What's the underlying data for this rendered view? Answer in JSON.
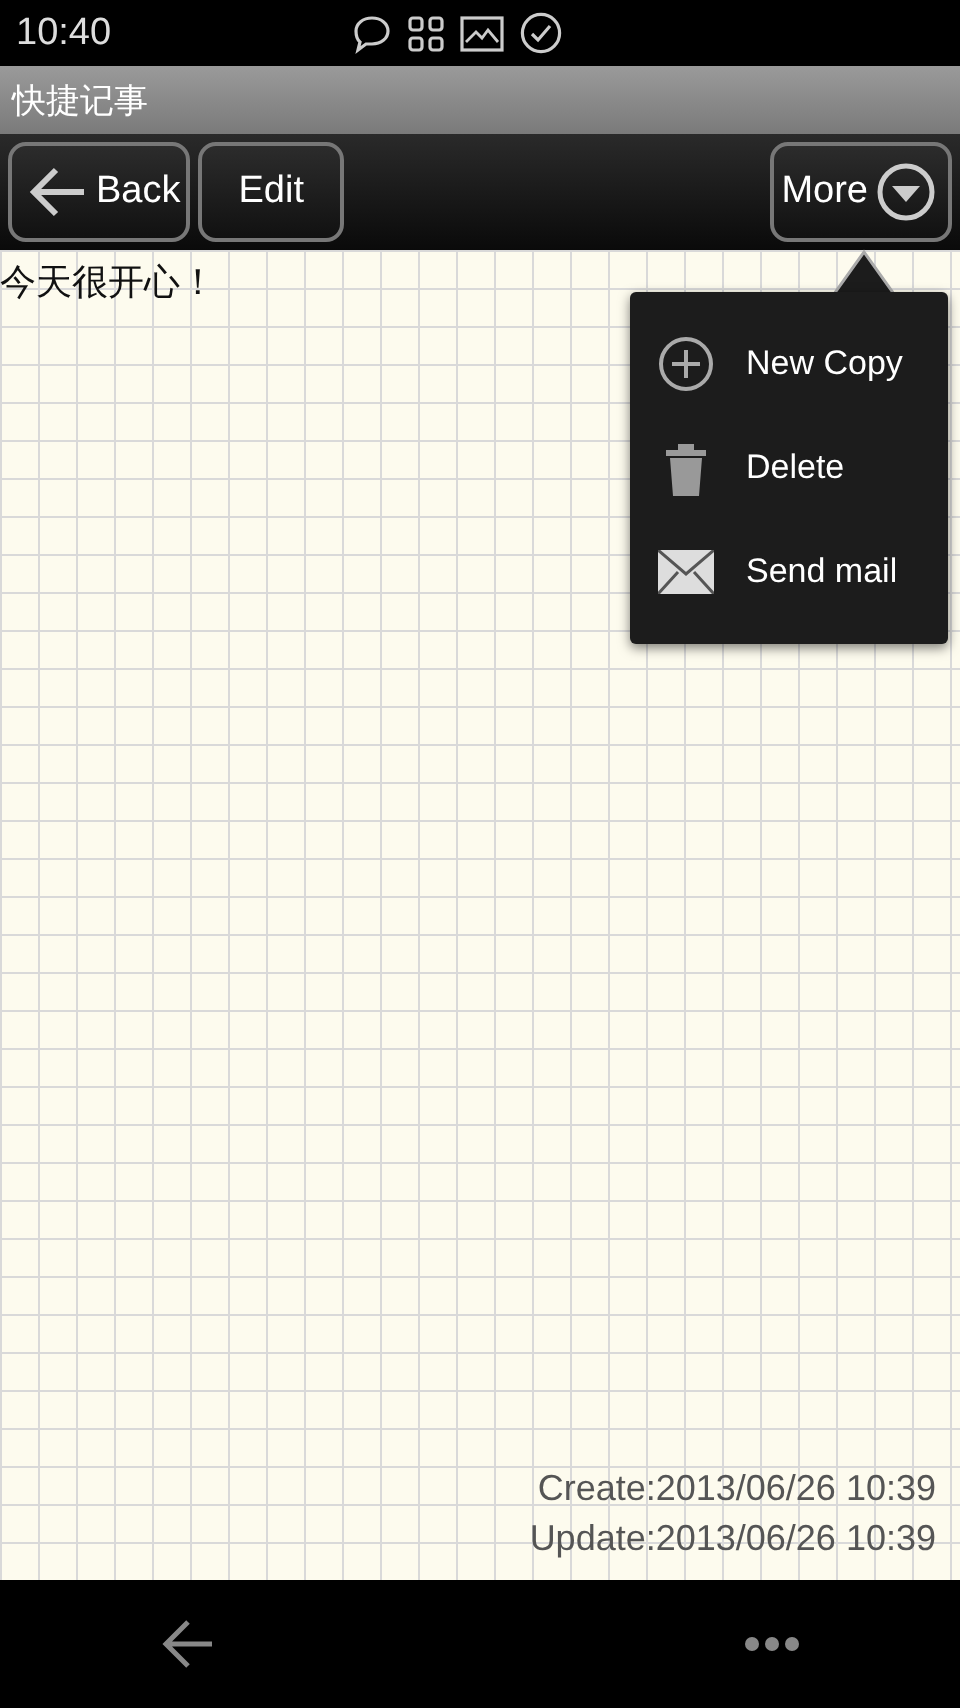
{
  "status_bar": {
    "time": "10:40"
  },
  "window": {
    "title": "快捷记事"
  },
  "toolbar": {
    "buttons": [
      {
        "label": "Back",
        "kind": "back"
      },
      {
        "label": "Edit",
        "kind": "plain"
      },
      {
        "label": "More",
        "kind": "more"
      }
    ]
  },
  "note": {
    "text": "今天很开心！",
    "created": "Create:2013/06/26 10:39",
    "updated": "Update:2013/06/26 10:39"
  },
  "menu": {
    "items": [
      {
        "label": "New Copy",
        "kind": "add"
      },
      {
        "label": "Delete",
        "kind": "delete"
      },
      {
        "label": "Send mail",
        "kind": "mail"
      }
    ]
  }
}
